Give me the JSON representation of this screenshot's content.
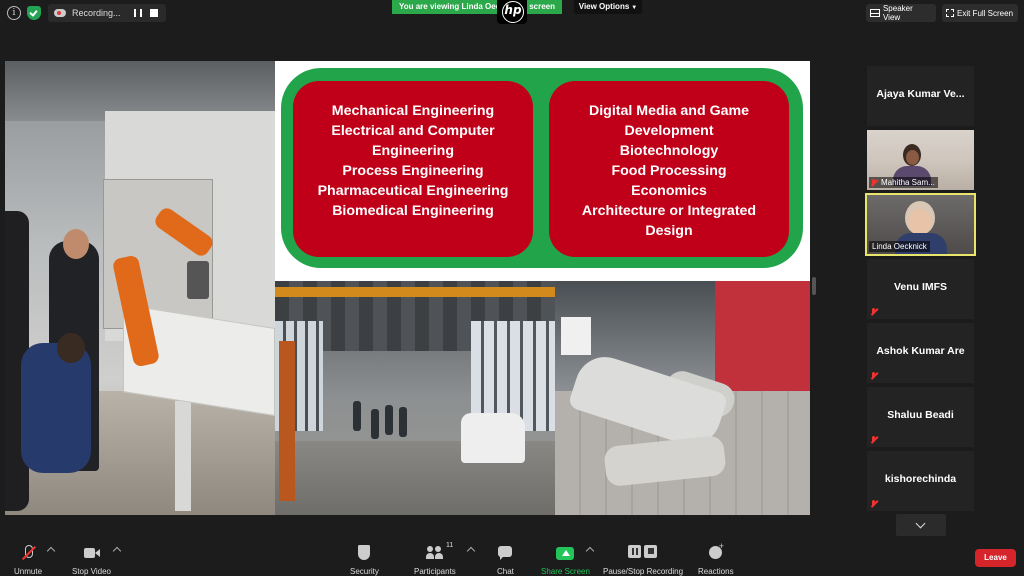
{
  "topbar": {
    "recording_label": "Recording...",
    "banner_text": "You are viewing Linda Oecknick's screen",
    "view_options_label": "View Options",
    "speaker_view_label": "Speaker View",
    "exit_fullscreen_label": "Exit Full Screen"
  },
  "slide": {
    "left_lines": [
      "Mechanical Engineering",
      "Electrical and Computer",
      "Engineering",
      "Process Engineering",
      "Pharmaceutical Engineering",
      "Biomedical Engineering"
    ],
    "right_lines": [
      "Digital Media and Game",
      "Development",
      "Biotechnology",
      "Food Processing",
      "Economics",
      "Architecture or Integrated",
      "Design"
    ],
    "colors": {
      "frame_green": "#22a44a",
      "box_red": "#c00019"
    }
  },
  "participants": [
    {
      "name": "Ajaya Kumar Ve...",
      "video": false,
      "muted": false
    },
    {
      "name": "Mahitha Sam...",
      "video": true,
      "muted": true
    },
    {
      "name": "Linda Oecknick",
      "video": true,
      "muted": false,
      "active": true
    },
    {
      "name": "Venu IMFS",
      "video": false,
      "muted": true
    },
    {
      "name": "Ashok Kumar Are",
      "video": false,
      "muted": true
    },
    {
      "name": "Shaluu Beadi",
      "video": false,
      "muted": true
    },
    {
      "name": "kishorechinda",
      "video": false,
      "muted": true
    }
  ],
  "toolbar": {
    "unmute": "Unmute",
    "stop_video": "Stop Video",
    "security": "Security",
    "participants": "Participants",
    "participants_count": "11",
    "chat": "Chat",
    "share_screen": "Share Screen",
    "pause_stop_recording": "Pause/Stop Recording",
    "reactions": "Reactions",
    "leave": "Leave"
  },
  "icons": {
    "info": "info-icon",
    "encryption": "shield-check-icon",
    "recording": "cloud-record-icon",
    "mic": "mic-muted-icon",
    "camera": "camera-icon",
    "security": "shield-icon",
    "participants": "people-icon",
    "chat": "chat-bubble-icon",
    "share": "share-screen-icon",
    "record": "pause-stop-icon",
    "reactions": "emoji-plus-icon"
  }
}
